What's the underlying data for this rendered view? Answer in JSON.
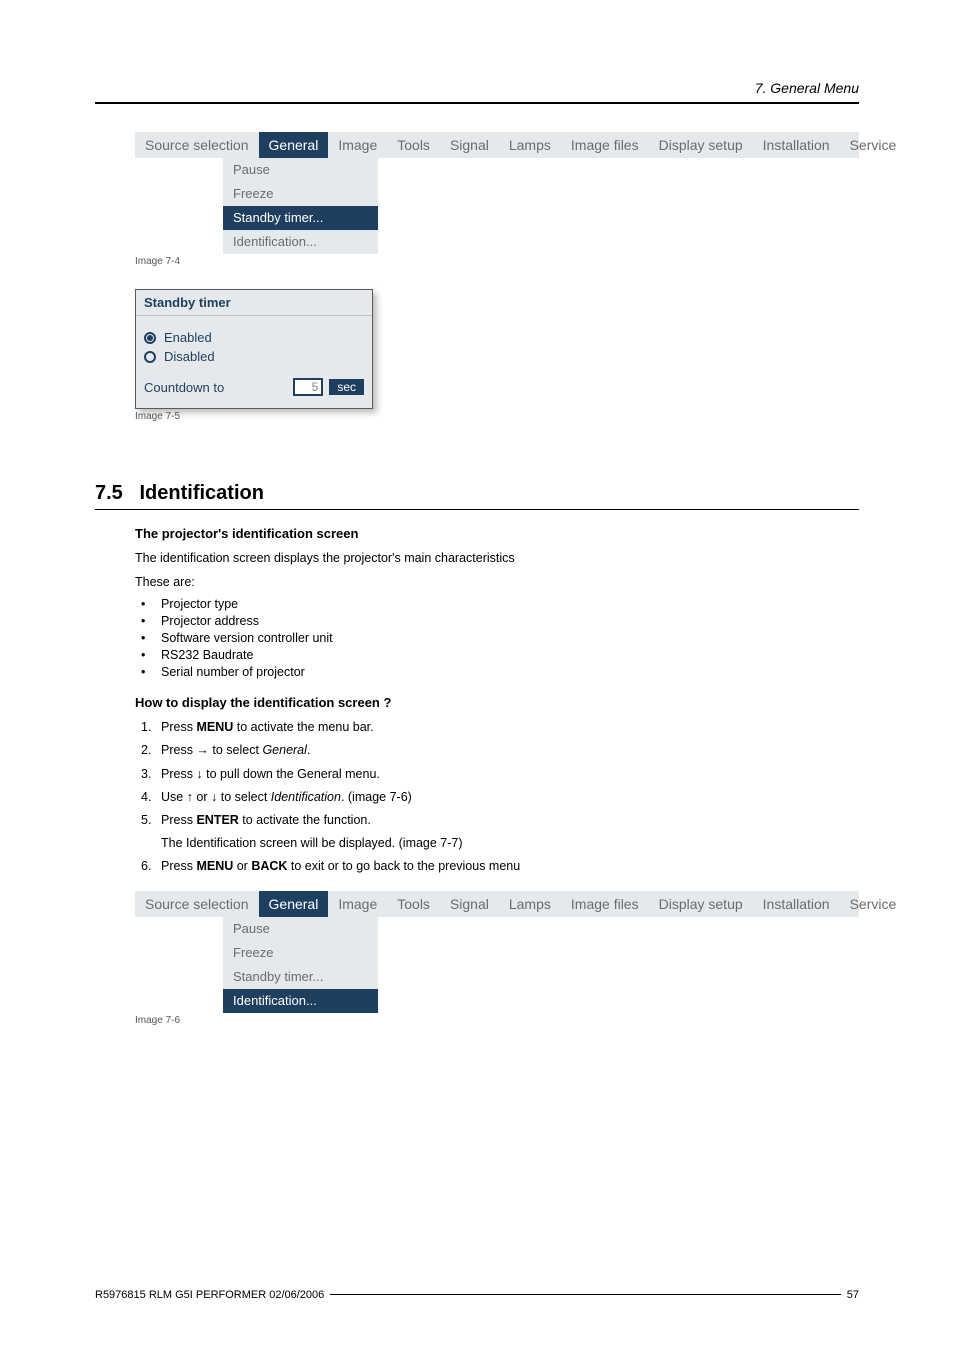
{
  "header": {
    "title": "7. General Menu"
  },
  "menubar": {
    "left_label": "Source selection",
    "items": [
      "General",
      "Image",
      "Tools",
      "Signal",
      "Lamps",
      "Image files",
      "Display setup",
      "Installation",
      "Service"
    ],
    "selected": "General"
  },
  "dropdown1": {
    "items": [
      "Pause",
      "Freeze",
      "Standby timer...",
      "Identification..."
    ],
    "selected": "Standby timer..."
  },
  "captions": {
    "img74": "Image 7-4",
    "img75": "Image 7-5",
    "img76": "Image 7-6"
  },
  "dialog": {
    "title": "Standby timer",
    "opt_enabled": "Enabled",
    "opt_disabled": "Disabled",
    "countdown_label": "Countdown to",
    "countdown_value": "5",
    "sec_label": "sec"
  },
  "section": {
    "number": "7.5",
    "title": "Identification",
    "sub1": "The projector's identification screen",
    "p1": "The identification screen displays the projector's main characteristics",
    "p2": "These are:",
    "bullets": [
      "Projector type",
      "Projector address",
      "Software version controller unit",
      "RS232 Baudrate",
      "Serial number of projector"
    ],
    "sub2": "How to display the identification screen ?",
    "steps": {
      "s1_a": "Press ",
      "s1_b": "MENU",
      "s1_c": " to activate the menu bar.",
      "s2_a": "Press → to select ",
      "s2_b": "General",
      "s2_c": ".",
      "s3": "Press ↓ to pull down the General menu.",
      "s4_a": "Use ↑ or ↓ to select ",
      "s4_b": "Identification",
      "s4_c": ". (image 7-6)",
      "s5_a": "Press ",
      "s5_b": "ENTER",
      "s5_c": " to activate the function.",
      "s5_sub": "The Identification screen will be displayed. (image 7-7)",
      "s6_a": "Press ",
      "s6_b": "MENU",
      "s6_c": " or ",
      "s6_d": "BACK",
      "s6_e": " to exit or to go back to the previous menu"
    }
  },
  "dropdown2": {
    "items": [
      "Pause",
      "Freeze",
      "Standby timer...",
      "Identification..."
    ],
    "selected": "Identification..."
  },
  "footer": {
    "left": "R5976815  RLM G5I PERFORMER  02/06/2006",
    "right": "57"
  }
}
